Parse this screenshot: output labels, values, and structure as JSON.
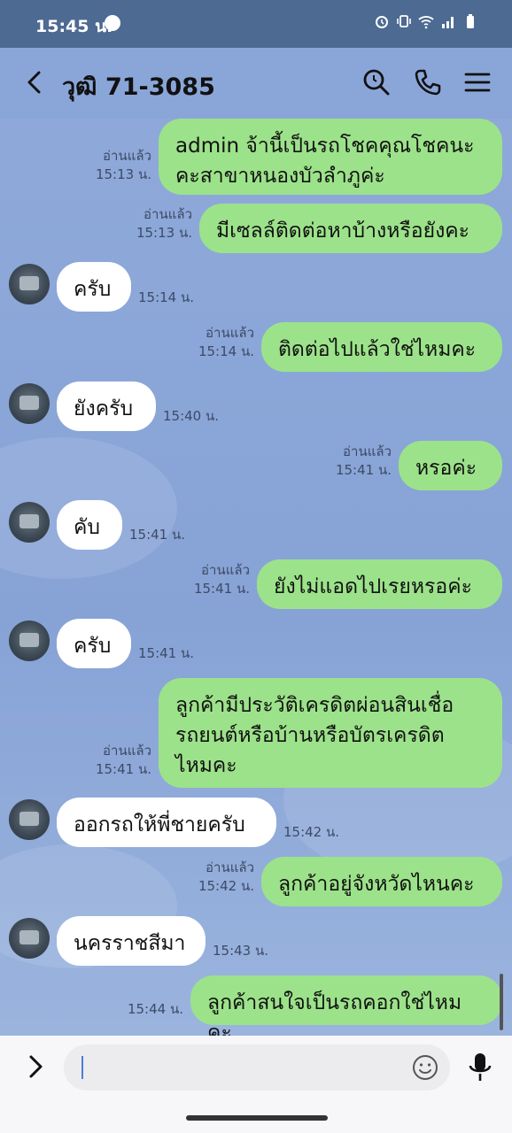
{
  "status_bar": {
    "time": "15:45 น."
  },
  "header": {
    "title": "วุฒิ 71-3085"
  },
  "messages": [
    {
      "dir": "out",
      "text": "admin จ้านี้เป็นรถโชคคุณโชคนะ\nคะสาขาหนองบัวลำภูค่ะ",
      "read": "อ่านแล้ว",
      "time": "15:13 น."
    },
    {
      "dir": "out",
      "text": "มีเซลล์ติดต่อหาบ้างหรือยังคะ",
      "read": "อ่านแล้ว",
      "time": "15:13 น."
    },
    {
      "dir": "in",
      "text": "ครับ",
      "time": "15:14 น."
    },
    {
      "dir": "out",
      "text": "ติดต่อไปแล้วใช่ไหมคะ",
      "read": "อ่านแล้ว",
      "time": "15:14 น."
    },
    {
      "dir": "in",
      "text": "ยังครับ",
      "time": "15:40 น."
    },
    {
      "dir": "out",
      "text": "หรอค่ะ",
      "read": "อ่านแล้ว",
      "time": "15:41 น."
    },
    {
      "dir": "in",
      "text": "คับ",
      "time": "15:41 น."
    },
    {
      "dir": "out",
      "text": "ยังไม่แอดไปเรยหรอค่ะ",
      "read": "อ่านแล้ว",
      "time": "15:41 น."
    },
    {
      "dir": "in",
      "text": "ครับ",
      "time": "15:41 น."
    },
    {
      "dir": "out",
      "text": "ลูกค้ามีประวัติเครดิตผ่อนสินเชื่อ\nรถยนต์หรือบ้านหรือบัตรเครดิต\nไหมคะ",
      "read": "อ่านแล้ว",
      "time": "15:41 น."
    },
    {
      "dir": "in",
      "text": "ออกรถให้พี่ชายครับ",
      "time": "15:42 น."
    },
    {
      "dir": "out",
      "text": "ลูกค้าอยู่จังหวัดไหนคะ",
      "read": "อ่านแล้ว",
      "time": "15:42 น."
    },
    {
      "dir": "in",
      "text": "นครราชสีมา",
      "time": "15:43 น."
    },
    {
      "dir": "out",
      "text": "ลูกค้าสนใจเป็นรถคอกใช่ไหมคะ",
      "read": "",
      "time": "15:44 น."
    }
  ],
  "icons": {
    "back": "chevron-left-icon",
    "search": "search-icon",
    "call": "phone-icon",
    "menu": "hamburger-menu-icon",
    "expand": "chevron-right-icon",
    "emoji": "smiley-icon",
    "mic": "microphone-icon"
  },
  "colors": {
    "outgoing_bubble": "#9ce28a",
    "incoming_bubble": "#ffffff",
    "chat_background": "#8aa6d8",
    "status_bar": "#4d6a92"
  }
}
